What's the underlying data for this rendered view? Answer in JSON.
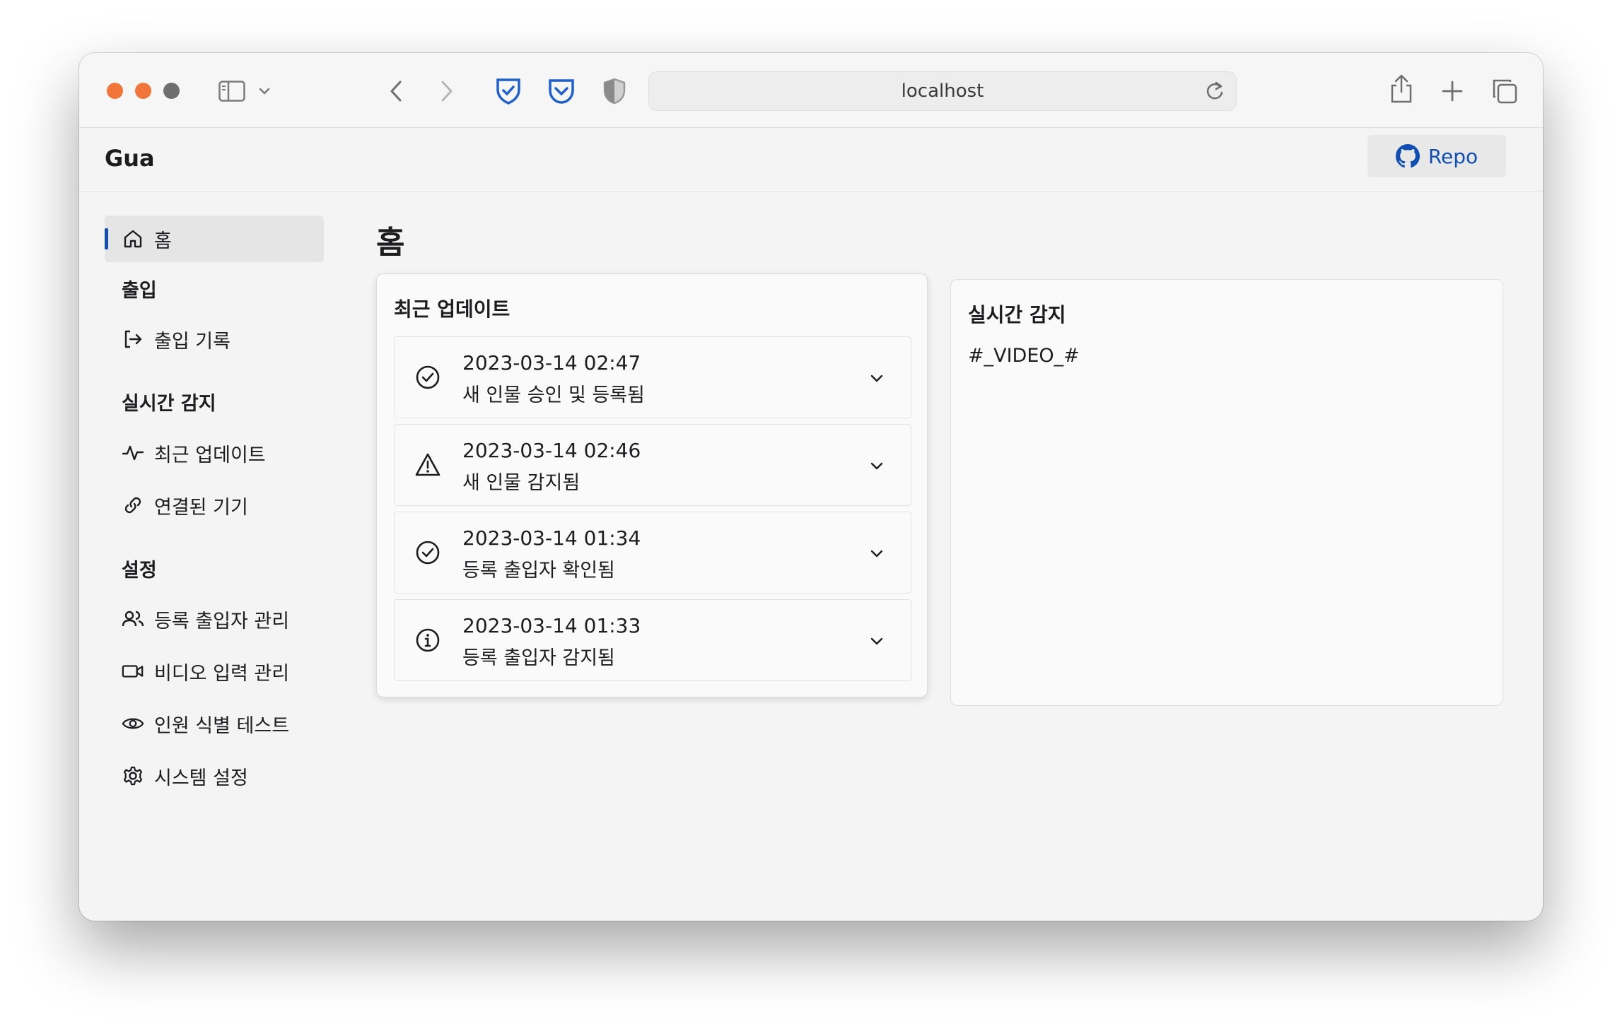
{
  "browser": {
    "url": "localhost",
    "colors": {
      "close": "#f2763b",
      "minimize": "#f2763b",
      "zoom": "#6e6e6e",
      "accent": "#0f4fb3"
    }
  },
  "app": {
    "brand": "Gua",
    "repo_label": "Repo"
  },
  "sidebar": {
    "home": "홈",
    "section_access": "출입",
    "access_log": "출입 기록",
    "section_live": "실시간 감지",
    "recent_updates": "최근 업데이트",
    "connected_devices": "연결된 기기",
    "section_settings": "설정",
    "registered_people": "등록 출입자 관리",
    "video_input": "비디오 입력 관리",
    "person_id_test": "인원 식별 테스트",
    "system_settings": "시스템 설정"
  },
  "main": {
    "title": "홈",
    "updates_card": {
      "title": "최근 업데이트",
      "items": [
        {
          "time": "2023-03-14 02:47",
          "desc": "새 인물 승인 및 등록됨",
          "icon": "check-circle-icon"
        },
        {
          "time": "2023-03-14 02:46",
          "desc": "새 인물 감지됨",
          "icon": "warning-icon"
        },
        {
          "time": "2023-03-14 01:34",
          "desc": "등록 출입자 확인됨",
          "icon": "check-circle-icon"
        },
        {
          "time": "2023-03-14 01:33",
          "desc": "등록 출입자 감지됨",
          "icon": "info-icon"
        }
      ]
    },
    "live_card": {
      "title": "실시간 감지",
      "video_placeholder": "#_VIDEO_#"
    }
  }
}
